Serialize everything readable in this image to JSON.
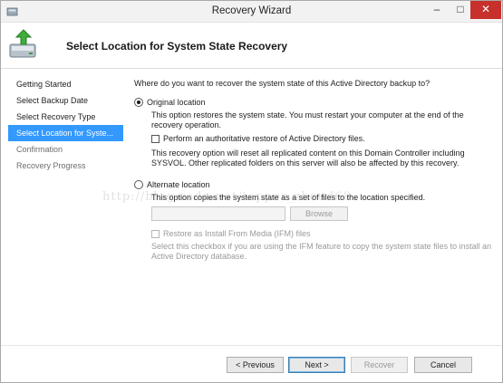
{
  "window": {
    "title": "Recovery Wizard",
    "minimize_glyph": "–",
    "maximize_glyph": "□",
    "close_glyph": "✕"
  },
  "header": {
    "title": "Select Location for System State Recovery",
    "icon": "backup-recovery-icon"
  },
  "sidebar": {
    "items": [
      {
        "label": "Getting Started",
        "state": "done"
      },
      {
        "label": "Select Backup Date",
        "state": "done"
      },
      {
        "label": "Select Recovery Type",
        "state": "done"
      },
      {
        "label": "Select Location for Syste...",
        "state": "active"
      },
      {
        "label": "Confirmation",
        "state": "future"
      },
      {
        "label": "Recovery Progress",
        "state": "future"
      }
    ]
  },
  "main": {
    "question": "Where do you want to recover the system state of this Active Directory backup to?",
    "original": {
      "label": "Original location",
      "selected": true,
      "description": "This option restores the system state. You must restart your computer at the end of the recovery operation.",
      "authoritative_label": "Perform an authoritative restore of Active Directory files.",
      "authoritative_checked": false,
      "warning": "This recovery option will reset all replicated content on this Domain Controller including SYSVOL. Other replicated folders on this server will also be affected by this recovery."
    },
    "alternate": {
      "label": "Alternate location",
      "selected": false,
      "description": "This option copies the system state as a set of files to the location specified.",
      "path_value": "",
      "browse_label": "Browse",
      "ifm_label": "Restore as Install From Media (IFM) files",
      "ifm_checked": false,
      "ifm_description": "Select this checkbox if you are using the IFM feature to copy the system state files to install an Active Directory database."
    }
  },
  "watermark": "http://blog.csdn.net/tapper_zhoud68",
  "footer": {
    "previous_label": "< Previous",
    "next_label": "Next >",
    "recover_label": "Recover",
    "cancel_label": "Cancel"
  },
  "colors": {
    "selection": "#3399ff",
    "close_button": "#c7302b",
    "disabled_text": "#9a9a9a"
  }
}
